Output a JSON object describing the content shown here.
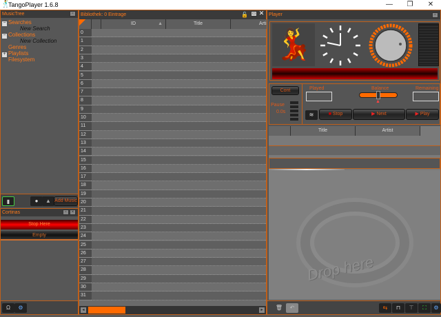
{
  "window": {
    "title": "TangoPlayer 1.6.8",
    "minimize": "—",
    "maximize": "❐",
    "close": "✕"
  },
  "musictree": {
    "title": "MusicTree",
    "items": [
      {
        "label": "Searches",
        "expander": "−"
      },
      {
        "label": "New Search"
      },
      {
        "label": "Collections",
        "expander": "−"
      },
      {
        "label": "New Collection"
      },
      {
        "label": "Genres"
      },
      {
        "label": "Playlists",
        "expander": "+"
      },
      {
        "label": "Filesystem"
      }
    ],
    "add_music": "Add Music"
  },
  "cortinas": {
    "title": "Cortinas",
    "stop_here": "Stop Here",
    "empty": "Empty"
  },
  "library": {
    "title": "Bibliothek:  0  Eintrage",
    "columns": [
      "ID",
      "Title",
      "Artist"
    ],
    "rows": [
      0,
      1,
      2,
      3,
      4,
      5,
      6,
      7,
      8,
      9,
      10,
      11,
      12,
      13,
      14,
      15,
      16,
      17,
      18,
      19,
      20,
      21,
      22,
      23,
      24,
      25,
      26,
      27,
      28,
      29,
      30,
      31
    ]
  },
  "player": {
    "title": "Player",
    "cont": "Cont",
    "played_label": "Played",
    "balance_label": "Balance",
    "remaining_label": "Remaining",
    "pause_label": "Pause",
    "pause_value": "0.0s",
    "stop": "Stop",
    "next": "Next",
    "play": "Play",
    "volume": 0.75
  },
  "queue": {
    "columns": [
      "Title",
      "Artist"
    ],
    "drop_text": "Drop here"
  },
  "colors": {
    "accent": "#ff7a1a",
    "red": "#e00000",
    "panel": "#575757"
  }
}
